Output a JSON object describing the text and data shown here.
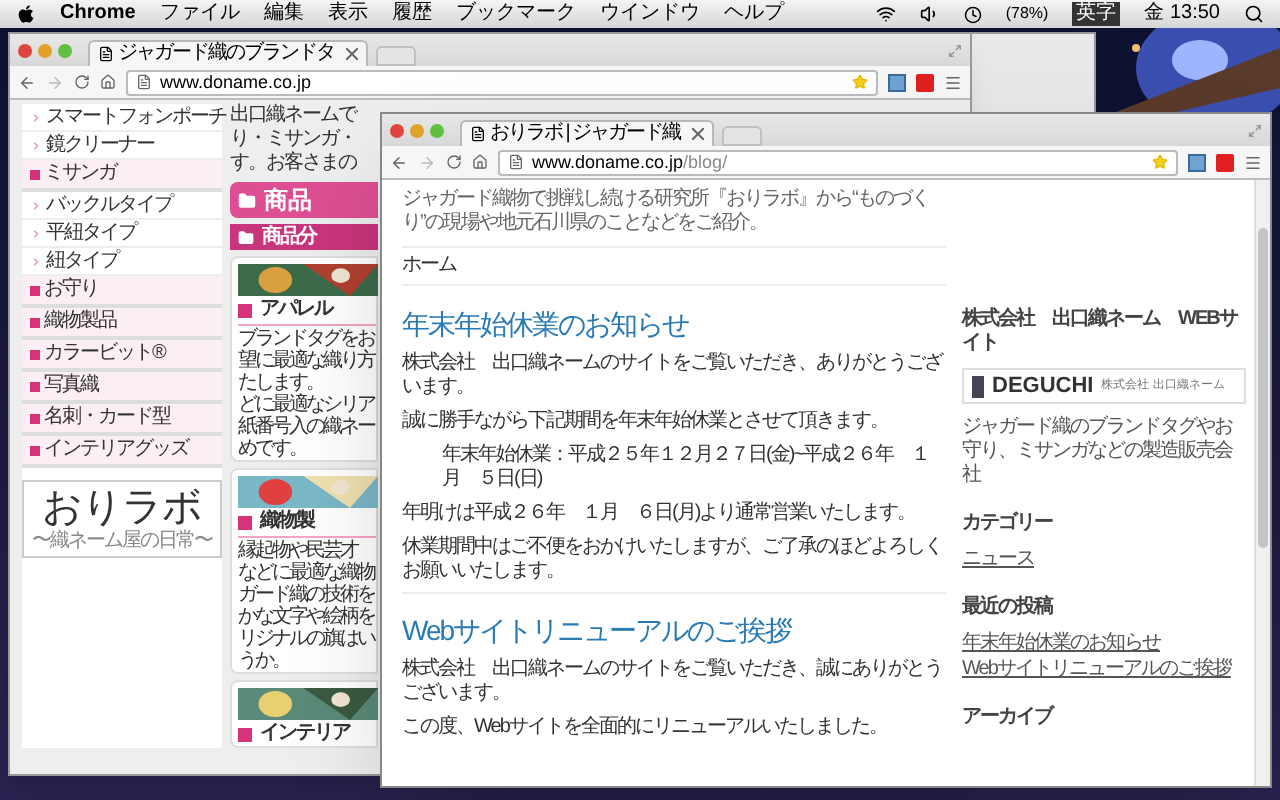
{
  "menu_bar": {
    "app": "Chrome",
    "menus": [
      "ファイル",
      "編集",
      "表示",
      "履歴",
      "ブックマーク",
      "ウインドウ",
      "ヘルプ"
    ],
    "battery": "(78%)",
    "input_mode": "英字",
    "clock": "金 13:50"
  },
  "back_window": {
    "tab_title": "ジャガード織のブランドタ",
    "url": "www.doname.co.jp",
    "sidebar": [
      {
        "label": "スマートフォンポーチ",
        "kind": "link"
      },
      {
        "label": "鏡クリーナー",
        "kind": "link"
      },
      {
        "label": "ミサンガ",
        "kind": "category"
      },
      {
        "label": "バックルタイプ",
        "kind": "link"
      },
      {
        "label": "平紐タイプ",
        "kind": "link"
      },
      {
        "label": "紐タイプ",
        "kind": "link"
      },
      {
        "label": "お守り",
        "kind": "category"
      },
      {
        "label": "織物製品",
        "kind": "category"
      },
      {
        "label": "カラービット®",
        "kind": "category"
      },
      {
        "label": "写真織",
        "kind": "category"
      },
      {
        "label": "名刺・カード型",
        "kind": "category"
      },
      {
        "label": "インテリアグッズ",
        "kind": "category"
      }
    ],
    "logo": {
      "title": "おりラボ",
      "subtitle": "〜織ネーム屋の日常〜"
    },
    "intro_lines": [
      "出口織ネームで",
      "り・ミサンガ・",
      "す。お客さまの"
    ],
    "banner": "商品",
    "section_banner": "商品分",
    "cards": [
      {
        "heading": "アパレル",
        "lines": [
          "ブランドタグをお",
          "望に最適な織り方",
          "たします。",
          "どに最適なシリア",
          "紙番号入の織ネー",
          "めです。"
        ]
      },
      {
        "heading": "織物製",
        "lines": [
          "縁起物や民芸才",
          "などに最適な織物",
          "ガード織の技術を",
          "かな文字や絵柄を",
          "リジナルの旗はい",
          "うか。"
        ]
      },
      {
        "heading": "インテリア"
      }
    ]
  },
  "front_window": {
    "tab_title": "おりラボ | ジャガード織",
    "url_host": "www.doname.co.jp",
    "url_path": "/blog/",
    "tagline": "ジャガード織物で挑戦し続ける研究所『おりラボ』から“ものづくり”の現場や地元石川県のことなどをご紹介。",
    "nav": [
      "ホーム"
    ],
    "posts": [
      {
        "title": "年末年始休業のお知らせ",
        "paragraphs": [
          {
            "text": "株式会社　出口織ネームのサイトをご覧いただき、ありがとうございます。",
            "kind": "plain"
          },
          {
            "text": "誠に勝手ながら下記期間を年末年始休業とさせて頂きます。",
            "kind": "plain"
          },
          {
            "text": "年末年始休業：平成２５年１２月２７日(金)~平成２６年　１月　５日(日)",
            "kind": "indented"
          },
          {
            "text": "年明けは平成２６年　１月　６日(月)より通常営業いたします。",
            "kind": "plain"
          },
          {
            "text": "休業期間中はご不便をおかけいたしますが、ご了承のほどよろしくお願いいたします。",
            "kind": "plain"
          }
        ]
      },
      {
        "title": "Webサイトリニューアルのご挨拶",
        "paragraphs": [
          {
            "text": "株式会社　出口織ネームのサイトをご覧いただき、誠にありがとうございます。",
            "kind": "plain"
          },
          {
            "text": "この度、Webサイトを全面的にリニューアルいたしました。",
            "kind": "plain"
          }
        ]
      }
    ],
    "sidebar": {
      "company_heading": "株式会社　出口織ネーム　WEBサイト",
      "logo_name": "DEGUCHI",
      "logo_caption": "株式会社 出口織ネーム",
      "company_text": "ジャガード織のブランドタグやお守り、ミサンガなどの製造販売会社",
      "category_heading": "カテゴリー",
      "categories": [
        "ニュース"
      ],
      "recent_heading": "最近の投稿",
      "recent_posts": [
        "年末年始休業のお知らせ",
        "Webサイトリニューアルのご挨拶"
      ],
      "archive_heading": "アーカイブ"
    }
  }
}
